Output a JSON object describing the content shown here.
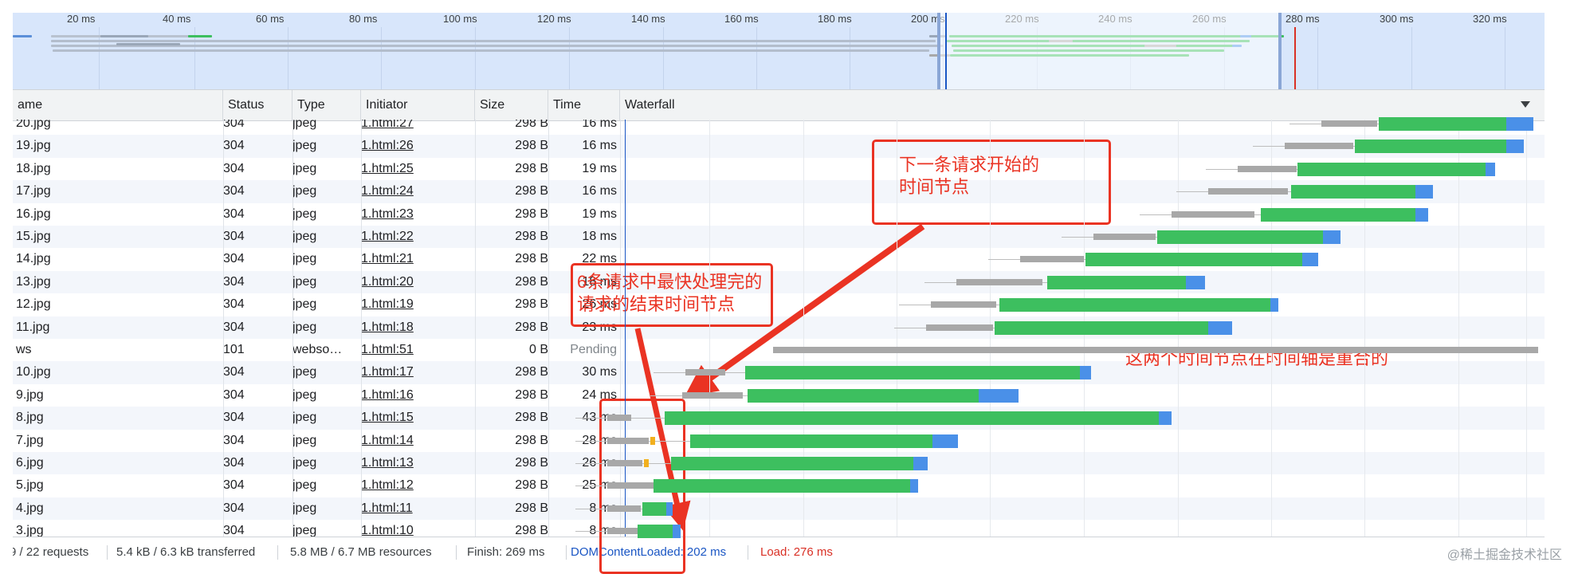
{
  "ruler": [
    "20 ms",
    "40 ms",
    "60 ms",
    "80 ms",
    "100 ms",
    "120 ms",
    "140 ms",
    "160 ms",
    "180 ms",
    "200 ms",
    "220 ms",
    "240 ms",
    "260 ms",
    "280 ms",
    "300 ms",
    "320 ms"
  ],
  "columns": {
    "name": "ame",
    "status": "Status",
    "type": "Type",
    "initiator": "Initiator",
    "size": "Size",
    "time": "Time",
    "waterfall": "Waterfall"
  },
  "rows": [
    {
      "name": "20.jpg",
      "status": "304",
      "type": "jpeg",
      "initiator": "1.html:27",
      "size": "298 B",
      "time": "16 ms"
    },
    {
      "name": "19.jpg",
      "status": "304",
      "type": "jpeg",
      "initiator": "1.html:26",
      "size": "298 B",
      "time": "16 ms"
    },
    {
      "name": "18.jpg",
      "status": "304",
      "type": "jpeg",
      "initiator": "1.html:25",
      "size": "298 B",
      "time": "19 ms"
    },
    {
      "name": "17.jpg",
      "status": "304",
      "type": "jpeg",
      "initiator": "1.html:24",
      "size": "298 B",
      "time": "16 ms"
    },
    {
      "name": "16.jpg",
      "status": "304",
      "type": "jpeg",
      "initiator": "1.html:23",
      "size": "298 B",
      "time": "19 ms"
    },
    {
      "name": "15.jpg",
      "status": "304",
      "type": "jpeg",
      "initiator": "1.html:22",
      "size": "298 B",
      "time": "18 ms"
    },
    {
      "name": "14.jpg",
      "status": "304",
      "type": "jpeg",
      "initiator": "1.html:21",
      "size": "298 B",
      "time": "22 ms"
    },
    {
      "name": "13.jpg",
      "status": "304",
      "type": "jpeg",
      "initiator": "1.html:20",
      "size": "298 B",
      "time": "18 ms"
    },
    {
      "name": "12.jpg",
      "status": "304",
      "type": "jpeg",
      "initiator": "1.html:19",
      "size": "298 B",
      "time": "26 ms"
    },
    {
      "name": "11.jpg",
      "status": "304",
      "type": "jpeg",
      "initiator": "1.html:18",
      "size": "298 B",
      "time": "23 ms"
    },
    {
      "name": "ws",
      "status": "101",
      "type": "webso…",
      "initiator": "1.html:51",
      "size": "0 B",
      "time": "Pending"
    },
    {
      "name": "10.jpg",
      "status": "304",
      "type": "jpeg",
      "initiator": "1.html:17",
      "size": "298 B",
      "time": "30 ms"
    },
    {
      "name": "9.jpg",
      "status": "304",
      "type": "jpeg",
      "initiator": "1.html:16",
      "size": "298 B",
      "time": "24 ms"
    },
    {
      "name": "8.jpg",
      "status": "304",
      "type": "jpeg",
      "initiator": "1.html:15",
      "size": "298 B",
      "time": "43 ms"
    },
    {
      "name": "7.jpg",
      "status": "304",
      "type": "jpeg",
      "initiator": "1.html:14",
      "size": "298 B",
      "time": "28 ms"
    },
    {
      "name": "6.jpg",
      "status": "304",
      "type": "jpeg",
      "initiator": "1.html:13",
      "size": "298 B",
      "time": "26 ms"
    },
    {
      "name": "5.jpg",
      "status": "304",
      "type": "jpeg",
      "initiator": "1.html:12",
      "size": "298 B",
      "time": "25 ms"
    },
    {
      "name": "4.jpg",
      "status": "304",
      "type": "jpeg",
      "initiator": "1.html:11",
      "size": "298 B",
      "time": "8 ms"
    },
    {
      "name": "3.jpg",
      "status": "304",
      "type": "jpeg",
      "initiator": "1.html:10",
      "size": "298 B",
      "time": "8 ms"
    }
  ],
  "footer": {
    "requests": "9 / 22 requests",
    "transferred": "5.4 kB / 6.3 kB transferred",
    "resources": "5.8 MB / 6.7 MB resources",
    "finish": "Finish: 269 ms",
    "dom": "DOMContentLoaded: 202 ms",
    "load": "Load: 276 ms"
  },
  "annotations": {
    "next_request": "下一条请求开始的\n时间节点",
    "fastest": "6条请求中最快处理完的\n请求的结束时间节点",
    "overlap": "这两个时间节点在时间轴是重合的"
  },
  "watermark": "@稀土掘金技术社区",
  "colors": {
    "annotation": "#ea3323",
    "download": "#3dbf5f",
    "receive": "#4a90e8",
    "waiting": "#a8a8a8",
    "dom_line": "#1a56c4",
    "load_line": "#d93025"
  },
  "icons": {
    "sort": "triangle-down-icon"
  }
}
